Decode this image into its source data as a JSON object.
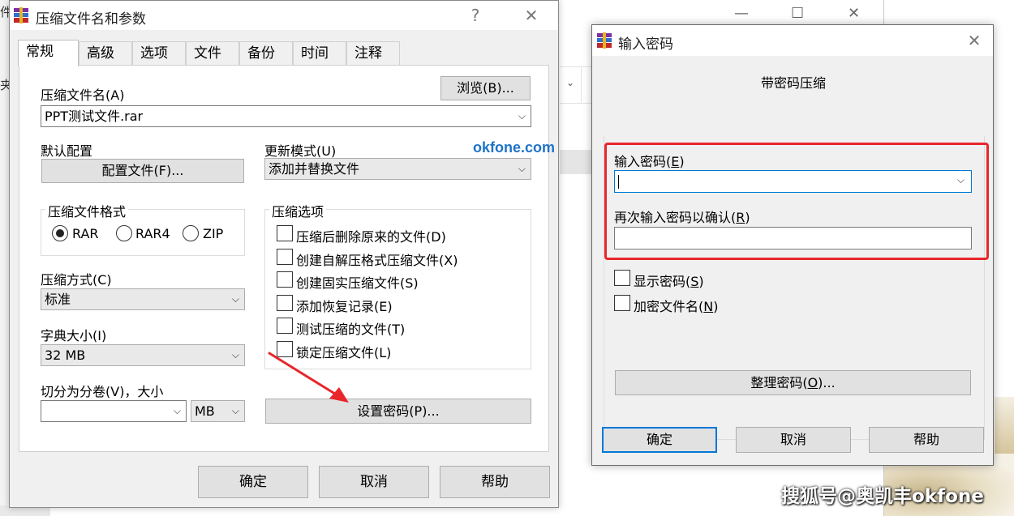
{
  "background": {
    "left_fragments": [
      "件",
      "夹"
    ],
    "controls": [
      "—",
      "☐",
      "✕"
    ]
  },
  "main_dialog": {
    "title": "压缩文件名和参数",
    "help_glyph": "?",
    "close_glyph": "✕",
    "tabs": [
      "常规",
      "高级",
      "选项",
      "文件",
      "备份",
      "时间",
      "注释"
    ],
    "active_tab": "常规",
    "archive_name_label": "压缩文件名(A)",
    "browse_button": "浏览(B)...",
    "archive_name_value": "PPT测试文件.rar",
    "default_profile_label": "默认配置",
    "profiles_button": "配置文件(F)...",
    "update_mode_label": "更新模式(U)",
    "update_mode_value": "添加并替换文件",
    "format_group_title": "压缩文件格式",
    "formats": [
      {
        "label": "RAR",
        "checked": true
      },
      {
        "label": "RAR4",
        "checked": false
      },
      {
        "label": "ZIP",
        "checked": false
      }
    ],
    "options_group_title": "压缩选项",
    "options": [
      "压缩后删除原来的文件(D)",
      "创建自解压格式压缩文件(X)",
      "创建固实压缩文件(S)",
      "添加恢复记录(E)",
      "测试压缩的文件(T)",
      "锁定压缩文件(L)"
    ],
    "method_label": "压缩方式(C)",
    "method_value": "标准",
    "dict_label": "字典大小(I)",
    "dict_value": "32 MB",
    "split_label": "切分为分卷(V)，大小",
    "split_value": "",
    "split_unit": "MB",
    "set_password_button": "设置密码(P)...",
    "ok": "确定",
    "cancel": "取消",
    "help": "帮助"
  },
  "site_watermark": "okfone.com",
  "password_dialog": {
    "title": "输入密码",
    "close_glyph": "✕",
    "heading": "带密码压缩",
    "enter_label_prefix": "输入密码(",
    "enter_label_key": "E",
    "enter_label_suffix": ")",
    "enter_value": "",
    "confirm_label_prefix": "再次输入密码以确认(",
    "confirm_label_key": "R",
    "confirm_label_suffix": ")",
    "confirm_value": "",
    "show_password_prefix": "显示密码(",
    "show_password_key": "S",
    "show_password_suffix": ")",
    "encrypt_names_prefix": "加密文件名(",
    "encrypt_names_key": "N",
    "encrypt_names_suffix": ")",
    "organize_prefix": "整理密码(",
    "organize_key": "O",
    "organize_suffix": ")...",
    "ok": "确定",
    "cancel": "取消",
    "help": "帮助"
  },
  "bottom_watermark": "搜狐号@奥凯丰okfone",
  "colors": {
    "highlight_box": "#e8262b",
    "focus_blue": "#0078d7",
    "site_blue": "#1e73c8"
  }
}
